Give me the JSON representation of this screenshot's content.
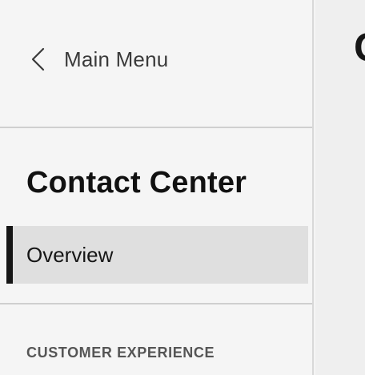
{
  "sidebar": {
    "back": {
      "label": "Main Menu",
      "icon": "chevron-left-icon"
    },
    "title": "Contact Center",
    "items": [
      {
        "label": "Overview",
        "active": true
      }
    ],
    "groups": [
      {
        "heading": "CUSTOMER EXPERIENCE"
      }
    ]
  },
  "main": {
    "title": "C"
  },
  "colors": {
    "sidebar_bg": "#f5f5f5",
    "active_item_bg": "#dfdfdf",
    "active_indicator": "#161616",
    "divider": "#cfcfcf"
  }
}
